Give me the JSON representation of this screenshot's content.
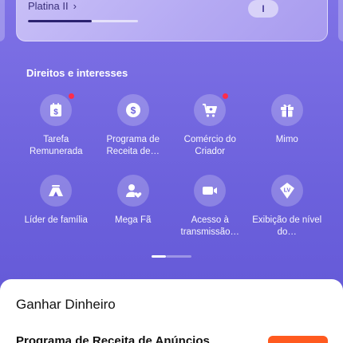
{
  "level_card": {
    "level_name": "Platina II",
    "chevron": "›",
    "progress": 0.58,
    "badge_text": "I"
  },
  "section": {
    "title": "Direitos e interesses"
  },
  "items": [
    {
      "label": "Tarefa Remunerada",
      "icon": "calendar-dollar-icon",
      "dot": true
    },
    {
      "label": "Programa de Receita de…",
      "icon": "dollar-coin-icon",
      "dot": false
    },
    {
      "label": "Comércio do Criador",
      "icon": "shopping-cart-icon",
      "dot": true
    },
    {
      "label": "Mimo",
      "icon": "gift-icon",
      "dot": false
    },
    {
      "label": "Líder de família",
      "icon": "tent-icon",
      "dot": false
    },
    {
      "label": "Mega Fã",
      "icon": "fan-heart-icon",
      "dot": false
    },
    {
      "label": "Acesso à transmissão…",
      "icon": "video-camera-icon",
      "dot": false
    },
    {
      "label": "Exibição de nível do…",
      "icon": "lv-badge-icon",
      "dot": false
    }
  ],
  "bottom_sheet": {
    "title": "Ganhar Dinheiro",
    "row_title": "Programa de Receita de Anúncios"
  },
  "colors": {
    "background": "#6c61dc",
    "notification_dot": "#ff2d4b",
    "cta": "#ff5a1f"
  }
}
